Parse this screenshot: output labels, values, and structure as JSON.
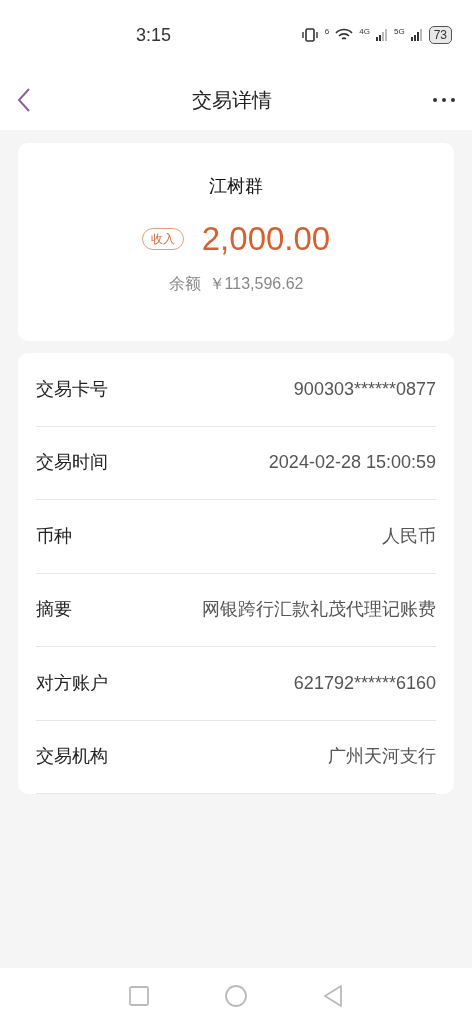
{
  "status_bar": {
    "time": "3:15",
    "wifi_badge": "6",
    "signal_1": "4G",
    "signal_2": "5G",
    "battery": "73"
  },
  "header": {
    "title": "交易详情"
  },
  "summary": {
    "name": "江树群",
    "tag": "收入",
    "amount": "2,000.00",
    "balance_label": "余额",
    "balance": "￥113,596.62"
  },
  "details": [
    {
      "label": "交易卡号",
      "value": "900303******0877"
    },
    {
      "label": "交易时间",
      "value": "2024-02-28 15:00:59"
    },
    {
      "label": "币种",
      "value": "人民币"
    },
    {
      "label": "摘要",
      "value": "网银跨行汇款礼茂代理记账费"
    },
    {
      "label": "对方账户",
      "value": "621792******6160"
    },
    {
      "label": "交易机构",
      "value": "广州天河支行"
    }
  ]
}
